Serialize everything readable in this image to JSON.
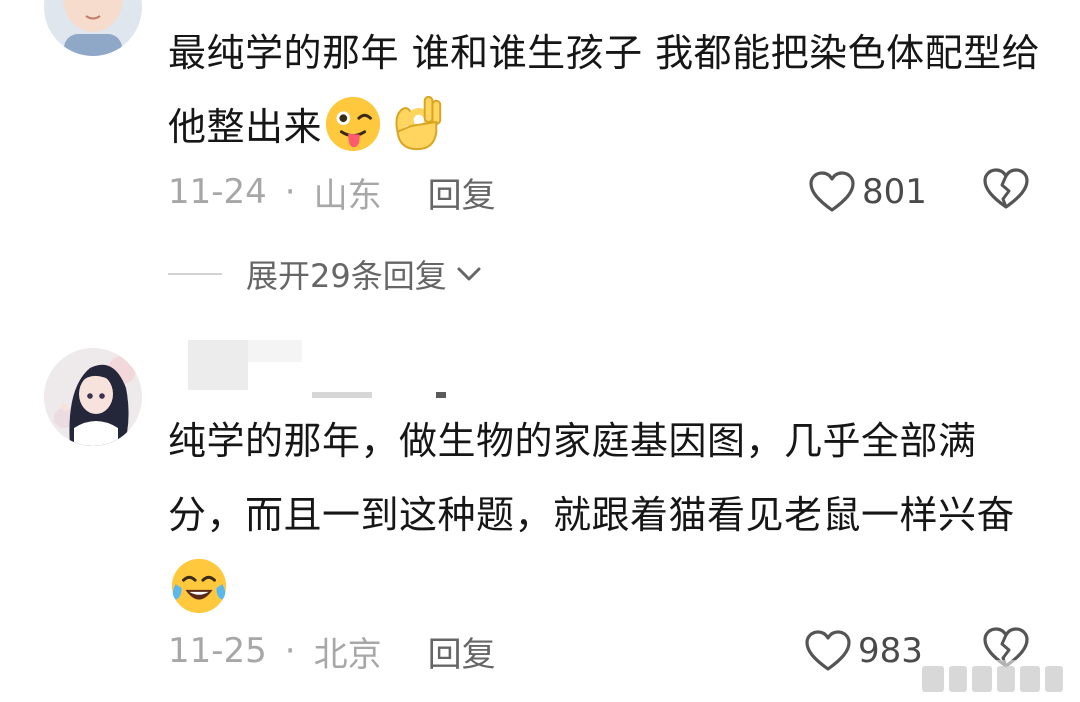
{
  "comments": [
    {
      "text": "最纯学的那年 谁和谁生孩子 我都能把染色体配型给他整出来",
      "emojis": [
        "tongue-wink-emoji",
        "ok-hand-emoji"
      ],
      "date": "11-24",
      "separator": "·",
      "location": "山东",
      "reply_label": "回复",
      "likes": "801",
      "expand_label": "展开29条回复"
    },
    {
      "text": "纯学的那年，做生物的家庭基因图，几乎全部满分，而且一到这种题，就跟着猫看见老鼠一样兴奋",
      "emojis": [
        "tears-of-joy-emoji"
      ],
      "date": "11-25",
      "separator": "·",
      "location": "北京",
      "reply_label": "回复",
      "likes": "983"
    }
  ],
  "icons": {
    "like": "heart-outline-icon",
    "dislike": "broken-heart-icon",
    "expand": "chevron-down-icon"
  },
  "colors": {
    "text": "#161616",
    "meta": "#a7a7a7",
    "reply": "#666666",
    "emoji_face": "#ffc83d"
  }
}
